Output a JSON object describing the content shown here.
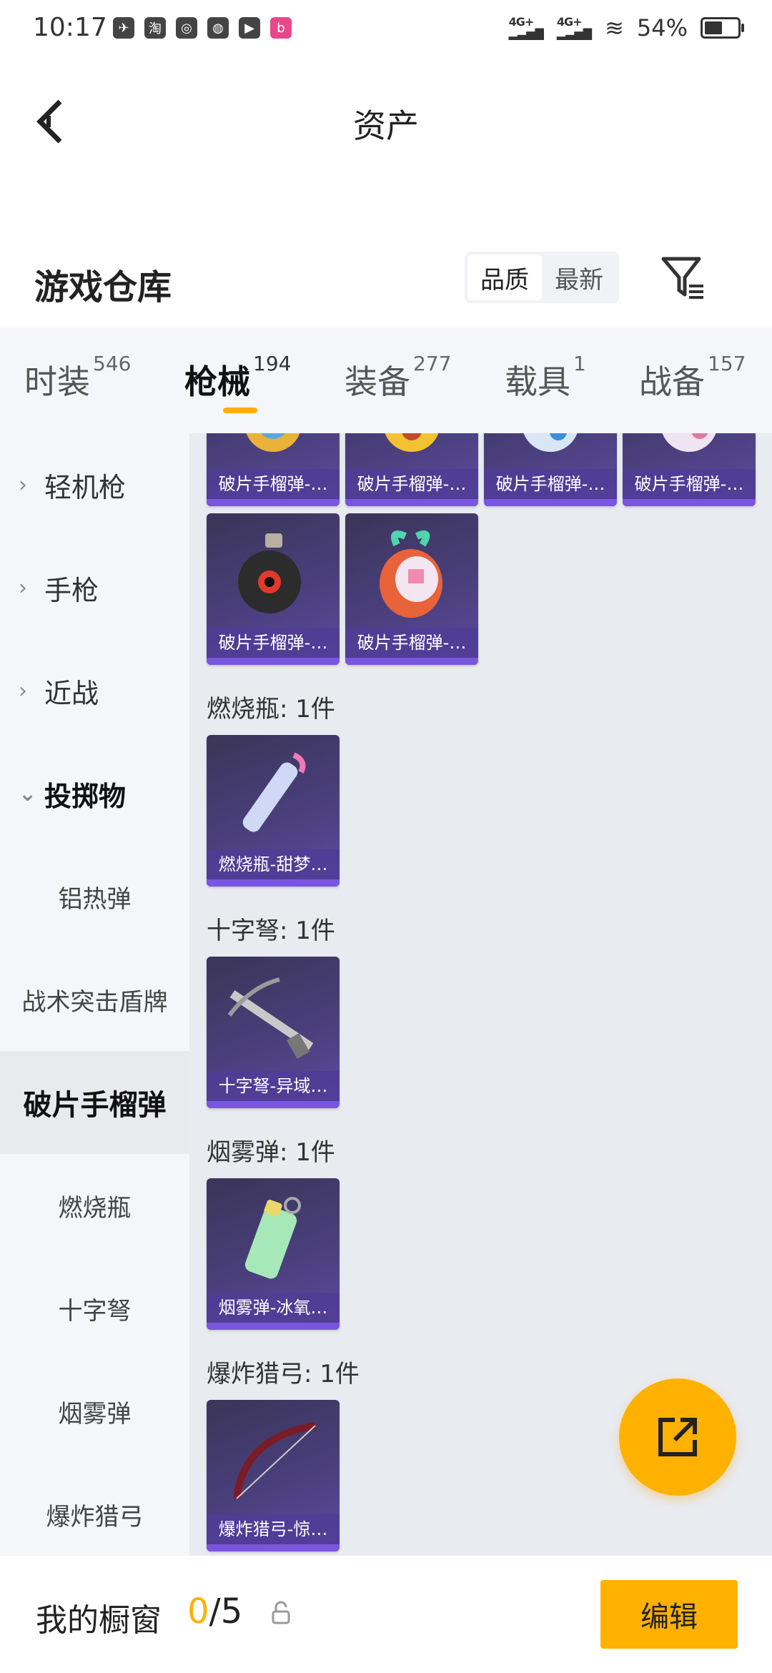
{
  "status_bar": {
    "time": "10:17",
    "app_icons": [
      "bird-icon",
      "taobao-icon",
      "game-icon",
      "leaf-icon",
      "play-icon",
      "bilibili-icon"
    ],
    "network1": "4G+",
    "network2": "4G+",
    "battery": "54%"
  },
  "header": {
    "title": "资产"
  },
  "warehouse": {
    "title": "游戏仓库",
    "sort_options": [
      "品质",
      "最新"
    ],
    "active_sort": "品质"
  },
  "tabs": [
    {
      "label": "时装",
      "count": "546"
    },
    {
      "label": "枪械",
      "count": "194",
      "active": true
    },
    {
      "label": "装备",
      "count": "277"
    },
    {
      "label": "载具",
      "count": "1"
    },
    {
      "label": "战备",
      "count": "157"
    }
  ],
  "sidebar": {
    "items": [
      {
        "label": "轻机枪"
      },
      {
        "label": "手枪"
      },
      {
        "label": "近战"
      },
      {
        "label": "投掷物"
      },
      {
        "label": "铝热弹"
      },
      {
        "label": "战术突击盾牌"
      },
      {
        "label": "破片手榴弹"
      },
      {
        "label": "燃烧瓶"
      },
      {
        "label": "十字弩"
      },
      {
        "label": "烟雾弹"
      },
      {
        "label": "爆炸猎弓"
      }
    ]
  },
  "content": {
    "top_row_captions": [
      "破片手榴弹-…",
      "破片手榴弹-…",
      "破片手榴弹-…",
      "破片手榴弹-…"
    ],
    "second_row_captions": [
      "破片手榴弹-…",
      "破片手榴弹-…"
    ],
    "sections": [
      {
        "label": "燃烧瓶: 1件",
        "caption": "燃烧瓶-甜梦…"
      },
      {
        "label": "十字弩: 1件",
        "caption": "十字弩-异域…"
      },
      {
        "label": "烟雾弹: 1件",
        "caption": "烟雾弹-冰氧…"
      },
      {
        "label": "爆炸猎弓: 1件",
        "caption": "爆炸猎弓-惊…"
      }
    ]
  },
  "bottom_bar": {
    "label": "我的橱窗",
    "current": "0",
    "total": "/5",
    "edit_label": "编辑"
  },
  "colors": {
    "accent": "#ffb100",
    "card_purple": "#4a3f7c"
  }
}
